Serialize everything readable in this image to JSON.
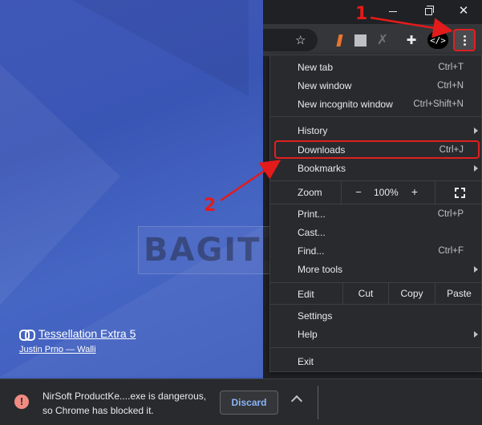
{
  "wallpaper": {
    "title": "Tessellation Extra 5",
    "author": "Justin Prno — Walli"
  },
  "toolbar": {
    "star_icon": "star-icon",
    "devtools_label": "</>"
  },
  "menu": {
    "items": [
      {
        "label": "New tab",
        "shortcut": "Ctrl+T"
      },
      {
        "label": "New window",
        "shortcut": "Ctrl+N"
      },
      {
        "label": "New incognito window",
        "shortcut": "Ctrl+Shift+N"
      },
      {
        "label": "History",
        "shortcut": ""
      },
      {
        "label": "Downloads",
        "shortcut": "Ctrl+J"
      },
      {
        "label": "Bookmarks",
        "shortcut": ""
      },
      {
        "label": "Print...",
        "shortcut": "Ctrl+P"
      },
      {
        "label": "Cast...",
        "shortcut": ""
      },
      {
        "label": "Find...",
        "shortcut": "Ctrl+F"
      },
      {
        "label": "More tools",
        "shortcut": ""
      },
      {
        "label": "Settings",
        "shortcut": ""
      },
      {
        "label": "Help",
        "shortcut": ""
      },
      {
        "label": "Exit",
        "shortcut": ""
      }
    ],
    "zoom": {
      "label": "Zoom",
      "minus": "−",
      "level": "100%",
      "plus": "+"
    },
    "edit": {
      "label": "Edit",
      "cut": "Cut",
      "copy": "Copy",
      "paste": "Paste"
    }
  },
  "annotations": {
    "step1": "1",
    "step2": "2"
  },
  "watermark": "BAGITEKNO",
  "download_bar": {
    "message_line1": "NirSoft ProductKe....exe is dangerous,",
    "message_line2": "so Chrome has blocked it.",
    "discard_label": "Discard",
    "warning_icon": "!"
  },
  "colors": {
    "annotation_red": "#e02020",
    "link_blue": "#8ab4f8",
    "menu_bg": "#292a2d"
  }
}
